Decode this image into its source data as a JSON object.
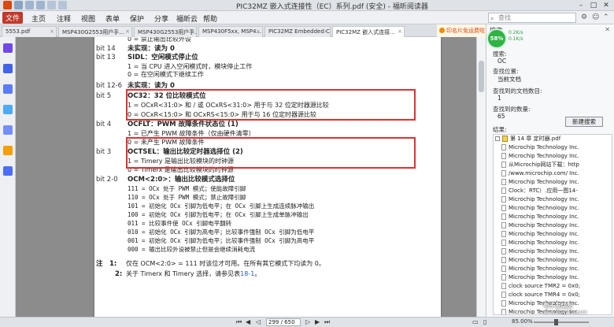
{
  "titlebar": {
    "title": "PIC32MZ 嵌入式连接性（EC）系列.pdf (安全) - 福昕阅读器"
  },
  "menubar": {
    "file": "文件",
    "items": [
      "主页",
      "注释",
      "视图",
      "表单",
      "保护",
      "分享",
      "福昕云",
      "帮助"
    ],
    "search_placeholder": "查找"
  },
  "tabs": [
    {
      "label": "5553.pdf"
    },
    {
      "label": "MSP430G2553用户手..."
    },
    {
      "label": "MSP430G2553用户手..."
    },
    {
      "label": "MSP430F5xx, MSP4..."
    },
    {
      "label": "PIC32MZ Embedded C..."
    },
    {
      "label": "PIC32MZ 嵌入式连接..."
    }
  ],
  "promo": "印名片免运费啦!",
  "page": {
    "lines": [
      {
        "bit": "",
        "text": "0 = 禁止输出比较外设",
        "kind": "sub"
      },
      {
        "bit": "bit 14",
        "text": "未实现：读为 0",
        "kind": "hd"
      },
      {
        "bit": "bit 13",
        "text": "SIDL：空闲模式停止位",
        "kind": "hd"
      },
      {
        "bit": "",
        "text": "1 = 当 CPU 进入空闲模式时，模块停止工作",
        "kind": "sub"
      },
      {
        "bit": "",
        "text": "0 = 在空闲模式下继续工作",
        "kind": "sub"
      },
      {
        "bit": "bit 12-6",
        "text": "未实现：读为 0",
        "kind": "hd"
      },
      {
        "bit": "bit 5",
        "text": "OC32：32 位比较模式位",
        "kind": "hd"
      },
      {
        "bit": "",
        "text": "1 = OCxR<31:0> 和 / 或 OCxRS<31:0> 用于与 32 位定时器源比较",
        "kind": "sub"
      },
      {
        "bit": "",
        "text": "0 = OCxR<15:0> 和 OCxRS<15:0> 用于与 16 位定时器源比较",
        "kind": "sub"
      },
      {
        "bit": "bit 4",
        "text": "OCFLT：PWM 故障条件状态位 (1)",
        "kind": "hd"
      },
      {
        "bit": "",
        "text": "1 = 已产生 PWM 故障条件（仅由硬件清零）",
        "kind": "sub"
      },
      {
        "bit": "",
        "text": "0 = 未产生 PWM 故障条件",
        "kind": "sub"
      },
      {
        "bit": "bit 3",
        "text": "OCTSEL：输出比较定时器选择位 (2)",
        "kind": "hd"
      },
      {
        "bit": "",
        "text": "1 = Timery 是输出比较模块的时钟源",
        "kind": "sub"
      },
      {
        "bit": "",
        "text": "0 = Timerx 是输出比较模块的时钟源",
        "kind": "sub"
      },
      {
        "bit": "bit 2-0",
        "text": "OCM<2:0>：输出比较模式选择位",
        "kind": "hd"
      },
      {
        "bit": "",
        "text": "111 = OCx 处于 PWM 模式；使能故障引脚",
        "kind": "mono"
      },
      {
        "bit": "",
        "text": "110 = OCx 处于 PWM 模式；禁止故障引脚",
        "kind": "mono"
      },
      {
        "bit": "",
        "text": "101 = 初始化 OCx 引脚为低电平；在 OCx 引脚上生成连续脉冲输出",
        "kind": "mono"
      },
      {
        "bit": "",
        "text": "100 = 初始化 OCx 引脚为低电平；在 OCx 引脚上生成单脉冲输出",
        "kind": "mono"
      },
      {
        "bit": "",
        "text": "011 = 比较事件使 OCx 引脚电平翻转",
        "kind": "mono"
      },
      {
        "bit": "",
        "text": "010 = 初始化 OCx 引脚为高电平；比较事件强制 OCx 引脚为低电平",
        "kind": "mono"
      },
      {
        "bit": "",
        "text": "001 = 初始化 OCx 引脚为低电平；比较事件强制 OCx 引脚为高电平",
        "kind": "mono"
      },
      {
        "bit": "",
        "text": "000 = 输出比较外设被禁止但是会继续消耗电流",
        "kind": "mono"
      }
    ],
    "notes": [
      {
        "n": "注　1:",
        "text": "仅在 OCM<2:0> = 111 时该位才可用。在所有其它模式下均读为 0。"
      },
      {
        "n": "2:",
        "text": "关于 Timerx 和 Timery 选择，请参见表",
        "link": "18-1",
        "tail": "。"
      }
    ]
  },
  "panel": {
    "title": "搜索",
    "search_label": "搜索:",
    "search_value": "OC",
    "location_label": "查找位置:",
    "location_value": "当前文档",
    "count_label": "查找到的文档数目:",
    "count_value": "1",
    "instances_label": "查找到的数量:",
    "instances_value": "65",
    "result_label": "结果:",
    "new_search": "新建搜索",
    "progress": "58%",
    "speed_up": "0.2K/s",
    "speed_down": "0.1K/s",
    "results": [
      "第 14 章 定时器.pdf",
      "Microchip Technology Inc.",
      "Microchip Technology Inc.",
      "从Microchip网站下载：http",
      "/www.microchip.com/ Inc.",
      "Microchip Technology Inc.",
      "Clock：RTC）.应用一图14-",
      "Microchip Technology Inc.",
      "Microchip Technology Inc.",
      "Microchip Technology Inc.",
      "Microchip Technology Inc.",
      "Microchip Technology Inc.",
      "Microchip Technology Inc.",
      "Microchip Technology Inc.",
      "Microchip Technology Inc.",
      "Microchip Technology Inc.",
      "Microchip Technology Inc.",
      "clock source TMR2 = 0x0;",
      "clock source TMR4 = 0x0;",
      "Microchip Technology Inc.",
      "Microchip Technology Inc."
    ]
  },
  "status": {
    "page": "299 / 650",
    "zoom": "85.00%"
  },
  "watermark": {
    "main": "电子发烧友",
    "sub": "www.elecfans.com"
  },
  "colors": {
    "highlight_box": "#e03131",
    "file_menu": "#c0392b",
    "progress": "#2fb344"
  }
}
